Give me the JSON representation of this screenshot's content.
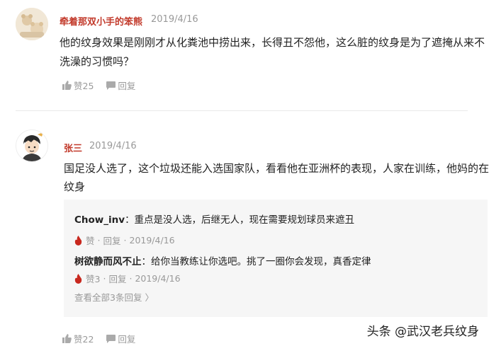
{
  "comments": [
    {
      "name": "牵着那双小手的笨熊",
      "date": "2019/4/16",
      "lines": [
        "他的纹身效果是刚刚才从化粪池中捞出来，长得丑不怨他，这么脏的纹身是为了遮掩从来不",
        "洗澡的习惯吗？"
      ],
      "like_label": "赞25",
      "reply_label": "回复"
    },
    {
      "name": "张三",
      "date": "2019/4/16",
      "lines": [
        "国足没人选了，这个垃圾还能入选国家队，看看他在亚洲杯的表现，人家在训练，他妈的在",
        "纹身"
      ],
      "like_label": "赞22",
      "reply_label": "回复",
      "replies": [
        {
          "user": "Chow_inv",
          "text": "：重点是没人选，后继无人，现在需要规划球员来遮丑",
          "like": "赞",
          "reply": "回复",
          "date": "2019/4/16"
        },
        {
          "user": "树欲静而风不止",
          "text": "：给你当教练让你选吧。挑了一圈你会发现，真香定律",
          "like": "赞3",
          "reply": "回复",
          "date": "2019/4/16"
        }
      ],
      "more_replies": "查看全部3条回复"
    }
  ],
  "watermark": "头条 @武汉老兵纹身",
  "colors": {
    "name": "#c23a2b",
    "meta": "#999999",
    "reply_bg": "#f6f6f6",
    "fire": "#c8281e"
  }
}
